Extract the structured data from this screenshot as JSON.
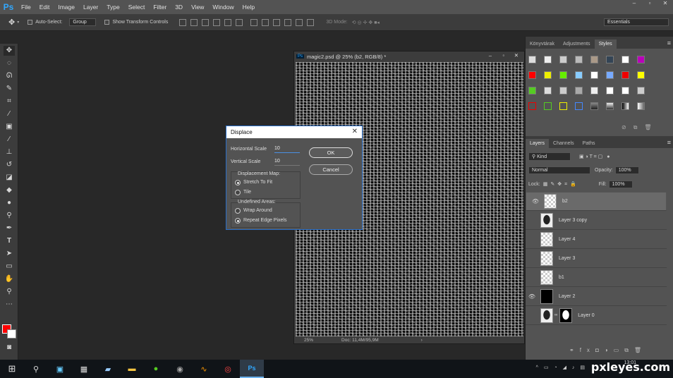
{
  "app": {
    "logo": "Ps"
  },
  "menu": [
    "File",
    "Edit",
    "Image",
    "Layer",
    "Type",
    "Select",
    "Filter",
    "3D",
    "View",
    "Window",
    "Help"
  ],
  "options_bar": {
    "auto_select_label": "Auto-Select:",
    "auto_select_value": "Group",
    "show_transform_label": "Show Transform Controls",
    "mode_label": "3D Mode:",
    "workspace": "Essentials"
  },
  "document": {
    "title": "magic2.psd @ 25% (b2, RGB/8) *",
    "zoom": "25%",
    "doc_size": "Doc: 11,4M/95,9M"
  },
  "top_panel": {
    "tabs": [
      "Könyvtárak",
      "Adjustments",
      "Styles"
    ],
    "active_tab": "Styles"
  },
  "layers_panel": {
    "tabs": [
      "Layers",
      "Channels",
      "Paths"
    ],
    "active_tab": "Layers",
    "filter_value": "Kind",
    "blend_mode": "Normal",
    "opacity_label": "Opacity:",
    "opacity_value": "100%",
    "lock_label": "Lock:",
    "fill_label": "Fill:",
    "fill_value": "100%",
    "layers": [
      {
        "name": "b2",
        "visible": true,
        "selected": true,
        "thumb": "transparent"
      },
      {
        "name": "Layer 3 copy",
        "visible": false,
        "selected": false,
        "thumb": "portrait"
      },
      {
        "name": "Layer 4",
        "visible": false,
        "selected": false,
        "thumb": "transparent"
      },
      {
        "name": "Layer 3",
        "visible": false,
        "selected": false,
        "thumb": "transparent"
      },
      {
        "name": "b1",
        "visible": false,
        "selected": false,
        "thumb": "transparent"
      },
      {
        "name": "Layer 2",
        "visible": true,
        "selected": false,
        "thumb": "black"
      },
      {
        "name": "Layer 0",
        "visible": false,
        "selected": false,
        "thumb": "portrait"
      }
    ]
  },
  "dialog": {
    "title": "Displace",
    "horizontal_scale_label": "Horizontal Scale",
    "horizontal_scale_value": "10",
    "vertical_scale_label": "Vertical Scale",
    "vertical_scale_value": "10",
    "ok_label": "OK",
    "cancel_label": "Cancel",
    "displacement_map_label": "Displacement Map:",
    "stretch_label": "Stretch To Fit",
    "tile_label": "Tile",
    "undefined_areas_label": "Undefined Areas:",
    "wrap_label": "Wrap Around",
    "repeat_label": "Repeat Edge Pixels",
    "displacement_map_selected": "Stretch To Fit",
    "undefined_areas_selected": "Repeat Edge Pixels"
  },
  "taskbar": {
    "time": "13:01",
    "watermark": "pxleyes.com"
  },
  "colors": {
    "foreground": "#ff0000",
    "background": "#ffffff",
    "accent": "#31a8ff"
  }
}
